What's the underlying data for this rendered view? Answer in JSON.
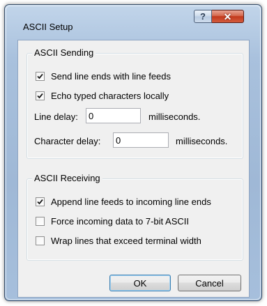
{
  "window": {
    "title": "ASCII Setup",
    "help_glyph": "?",
    "close_glyph": "✕"
  },
  "sending": {
    "legend": "ASCII Sending",
    "send_line_ends": {
      "label": "Send line ends with line feeds",
      "checked": true
    },
    "echo_typed": {
      "label": "Echo typed characters locally",
      "checked": true
    },
    "line_delay": {
      "label": "Line delay:",
      "value": "0",
      "unit": "milliseconds."
    },
    "char_delay": {
      "label": "Character delay:",
      "value": "0",
      "unit": "milliseconds."
    }
  },
  "receiving": {
    "legend": "ASCII Receiving",
    "append_line_feeds": {
      "label": "Append line feeds to incoming line ends",
      "checked": true
    },
    "force_7bit": {
      "label": "Force incoming data to 7-bit ASCII",
      "checked": false
    },
    "wrap_lines": {
      "label": "Wrap lines that exceed terminal width",
      "checked": false
    }
  },
  "buttons": {
    "ok": "OK",
    "cancel": "Cancel"
  },
  "icons": {
    "help": "help-icon",
    "close": "close-icon",
    "check": "checkmark-icon"
  }
}
